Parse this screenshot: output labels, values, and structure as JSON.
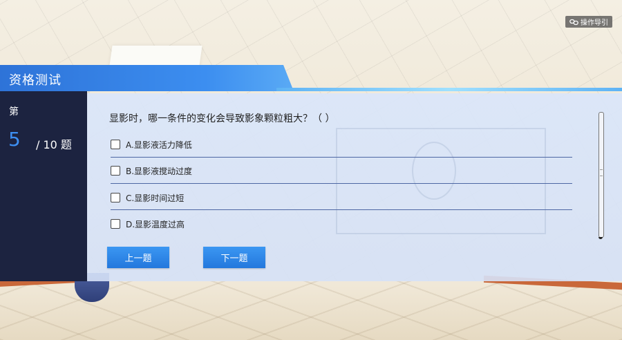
{
  "guide": {
    "label": "操作导引",
    "icon": "chain-link-icon"
  },
  "header": {
    "title": "资格测试"
  },
  "progress": {
    "prefix": "第",
    "current": "5",
    "total": "/ 10 题"
  },
  "question": {
    "text": "显影时，哪一条件的变化会导致影象颗粒粗大？（    ）",
    "options": [
      {
        "label": "A.显影液活力降低",
        "checked": false
      },
      {
        "label": "B.显影液搅动过度",
        "checked": false
      },
      {
        "label": "C.显影时间过短",
        "checked": false
      },
      {
        "label": "D.显影温度过高",
        "checked": false
      }
    ]
  },
  "buttons": {
    "prev": "上一题",
    "next": "下一题"
  },
  "colors": {
    "accent": "#3d8ff2",
    "sidebar": "#1c2340",
    "button": "#2a84e6"
  }
}
